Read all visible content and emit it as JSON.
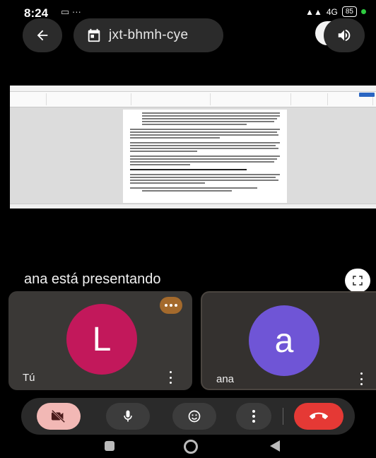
{
  "status_bar": {
    "time": "8:24",
    "left_icons": "▭ ···",
    "network": "4G",
    "battery": "85"
  },
  "top_bar": {
    "meeting_code": "jxt-bhmh-cye",
    "back_icon": "arrow-left-icon",
    "calendar_icon": "calendar-icon",
    "speaker_icon": "speaker-icon"
  },
  "presentation": {
    "presenting_label": "ana está presentando"
  },
  "tiles": [
    {
      "name": "Tú",
      "initial": "L",
      "color": "#c2185b"
    },
    {
      "name": "ana",
      "initial": "a",
      "color": "#6f55d6"
    }
  ],
  "controls": {
    "end_call_color": "#e53935",
    "camera_off_color": "#f2b8b5"
  }
}
